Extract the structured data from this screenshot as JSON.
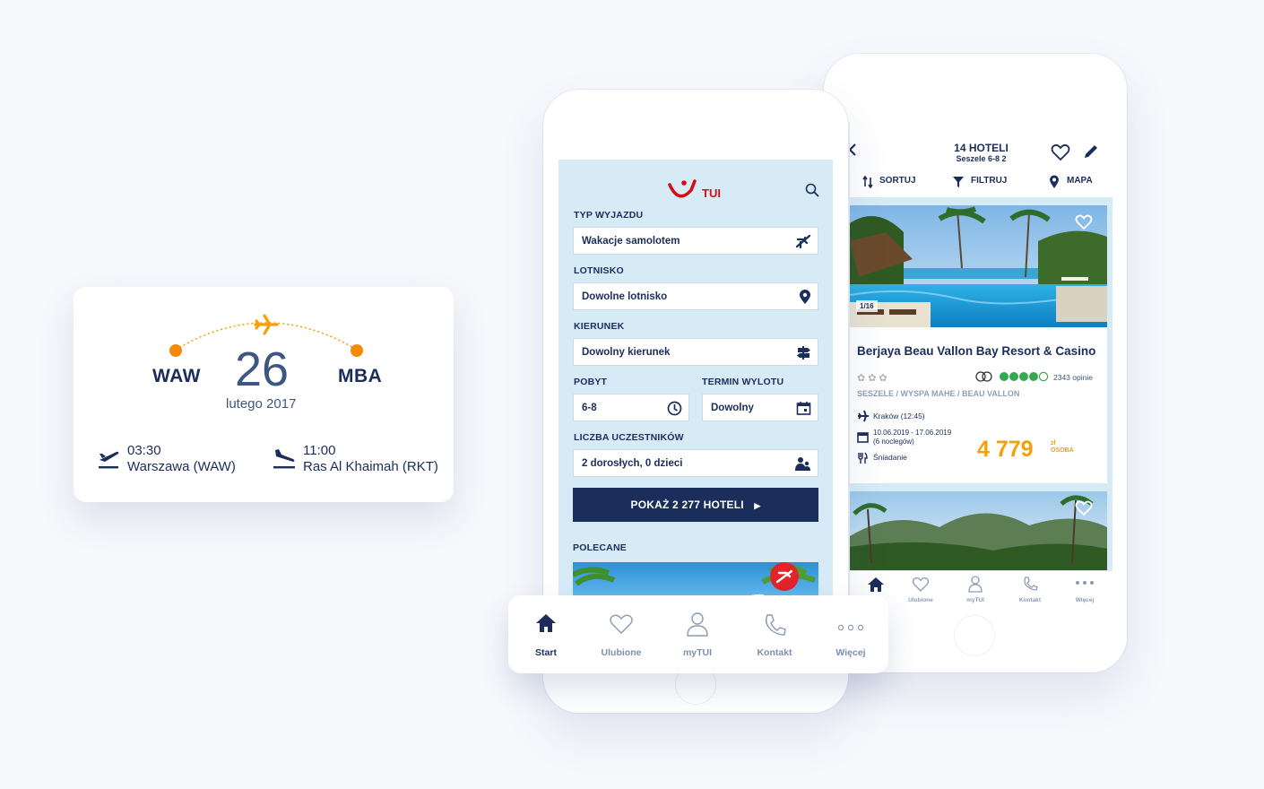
{
  "colors": {
    "navy": "#1b2d5b",
    "orange": "#f5a00a",
    "tui_red": "#d40e14",
    "light_blue": "#d7ebf7",
    "green_rating": "#34a853"
  },
  "flight_card": {
    "origin": "WAW",
    "destination": "MBA",
    "day": "26",
    "month_year": "lutego 2017",
    "departure": {
      "time": "03:30",
      "place": "Warszawa (WAW)",
      "icon": "plane-takeoff-icon"
    },
    "arrival": {
      "time": "11:00",
      "place": "Ras Al Khaimah (RKT)",
      "icon": "plane-landing-icon"
    }
  },
  "search_screen": {
    "logo_text": "TUI",
    "fields": {
      "trip_type": {
        "label": "TYP WYJAZDU",
        "value": "Wakacje samolotem",
        "icon": "plane-icon"
      },
      "airport": {
        "label": "LOTNISKO",
        "value": "Dowolne lotnisko",
        "icon": "location-pin-icon"
      },
      "direction": {
        "label": "KIERUNEK",
        "value": "Dowolny kierunek",
        "icon": "signpost-icon"
      },
      "stay": {
        "label": "POBYT",
        "value": "6-8",
        "icon": "clock-icon"
      },
      "date": {
        "label": "TERMIN WYLOTU",
        "value": "Dowolny",
        "icon": "calendar-icon"
      },
      "participants": {
        "label": "LICZBA UCZESTNIKÓW",
        "value": "2 dorosłych, 0 dzieci",
        "icon": "people-icon"
      }
    },
    "cta": "POKAŻ 2 277 HOTELI",
    "recommended_label": "POLECANE"
  },
  "tabbar": {
    "tabs": [
      {
        "label": "Start",
        "icon": "home-icon",
        "active": true
      },
      {
        "label": "Ulubione",
        "icon": "heart-icon",
        "active": false
      },
      {
        "label": "myTUI",
        "icon": "user-icon",
        "active": false
      },
      {
        "label": "Kontakt",
        "icon": "phone-icon",
        "active": false
      },
      {
        "label": "Więcej",
        "icon": "more-icon",
        "active": false
      }
    ]
  },
  "results_screen": {
    "title": "14 HOTELI",
    "subtitle": "Seszele  6-8  2",
    "toolbar": {
      "sort": "SORTUJ",
      "filter": "FILTRUJ",
      "map": "MAPA"
    },
    "hotels": [
      {
        "image_counter": "1/16",
        "name": "Berjaya Beau Vallon Bay Resort & Casino",
        "stars": 3,
        "tripadvisor_rating": 4.5,
        "reviews": "2343 opinie",
        "location": "SESZELE / WYSPA MAHE / BEAU VALLON",
        "flight": "Kraków (12:45)",
        "dates": "10.06.2019 - 17.06.2019",
        "nights": "(6 noclegów)",
        "board": "Śniadanie",
        "price": "4 779",
        "price_unit_top": "zł",
        "price_unit_bottom": "OSOBA"
      }
    ],
    "bottom_tabs": [
      "",
      "Ulubione",
      "myTUI",
      "Kontakt",
      "Więcej"
    ]
  }
}
